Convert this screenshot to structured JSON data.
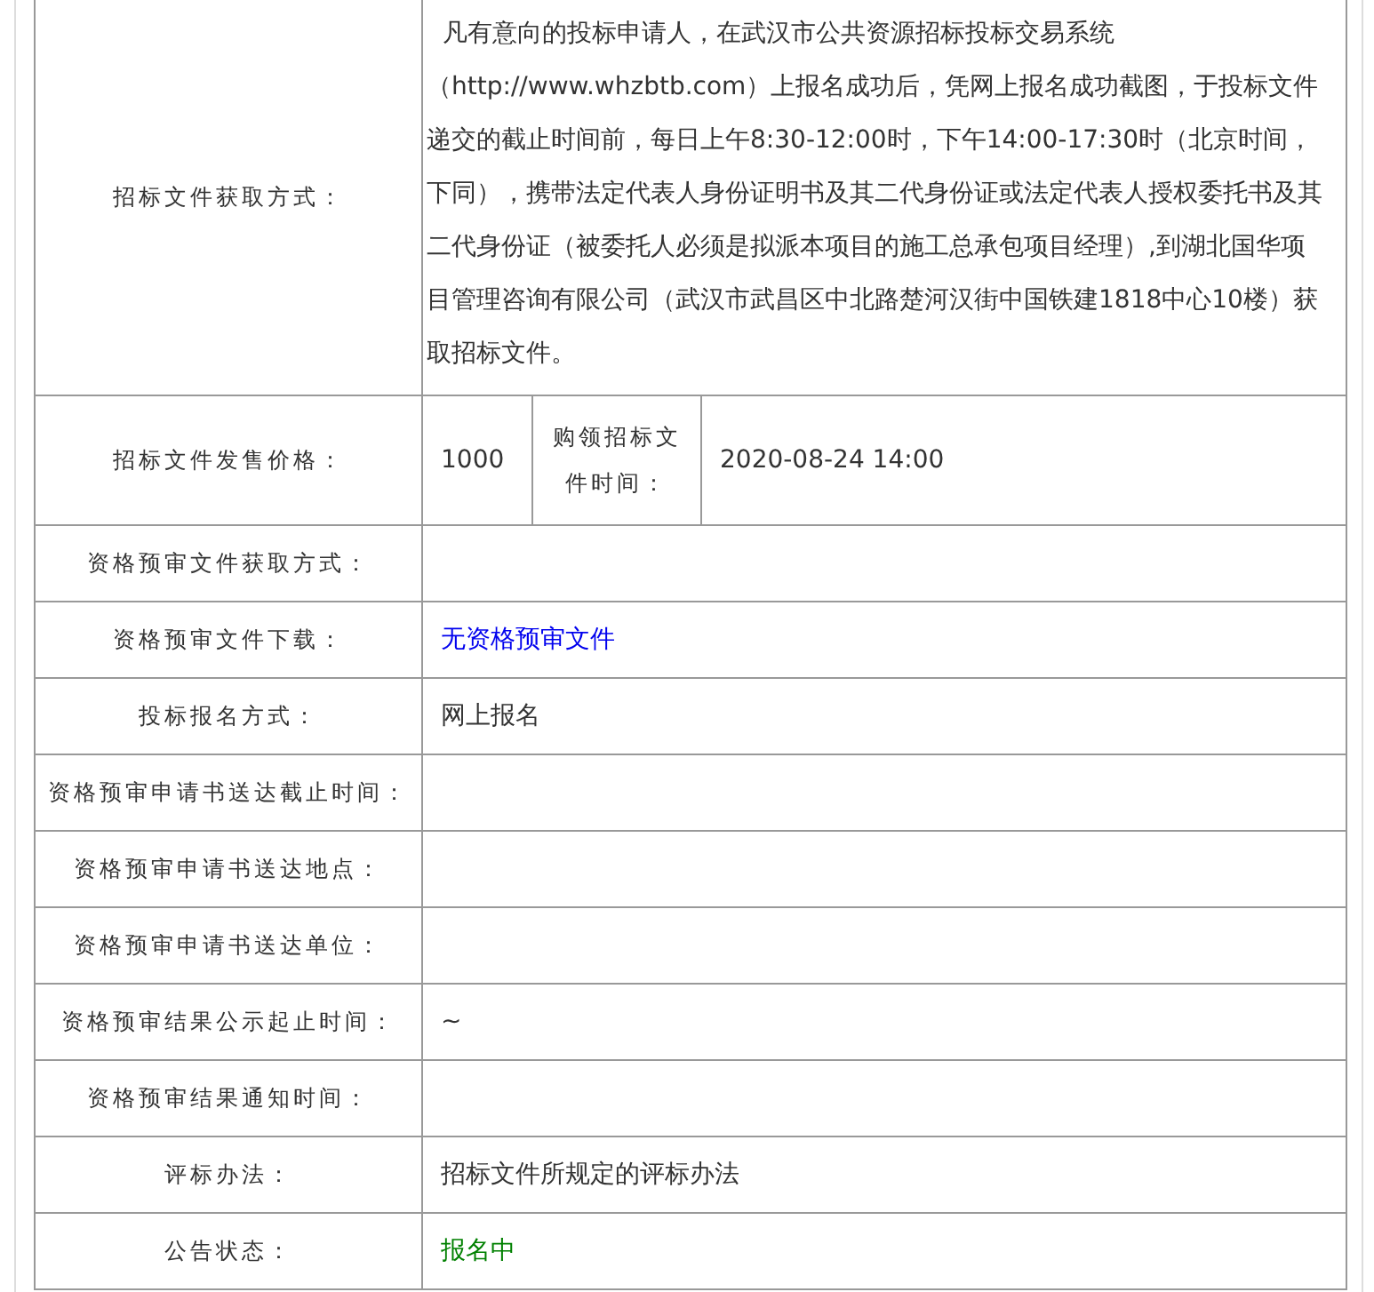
{
  "rows": [
    {
      "label": "招标文件获取方式：",
      "kind": "text",
      "text": "凡有意向的投标申请人，在武汉市公共资源招标投标交易系统（http://www.whzbtb.com）上报名成功后，凭网上报名成功截图，于投标文件递交的截止时间前，每日上午8:30-12:00时，下午14:00-17:30时（北京时间，下同），携带法定代表人身份证明书及其二代身份证或法定代表人授权委托书及其二代身份证（被委托人必须是拟派本项目的施工总承包项目经理）,到湖北国华项目管理咨询有限公司（武汉市武昌区中北路楚河汉街中国铁建1818中心10楼）获取招标文件。"
    },
    {
      "label": "招标文件发售价格：",
      "kind": "split",
      "text": "1000",
      "sublabel": "购领招标文件时间：",
      "subtext": "2020-08-24 14:00"
    },
    {
      "label": "资格预审文件获取方式：",
      "kind": "empty"
    },
    {
      "label": "资格预审文件下载：",
      "kind": "link",
      "text": "无资格预审文件"
    },
    {
      "label": "投标报名方式：",
      "kind": "text",
      "text": "网上报名"
    },
    {
      "label": "资格预审申请书送达截止时间：",
      "kind": "empty"
    },
    {
      "label": "资格预审申请书送达地点：",
      "kind": "empty"
    },
    {
      "label": "资格预审申请书送达单位：",
      "kind": "empty"
    },
    {
      "label": "资格预审结果公示起止时间：",
      "kind": "text",
      "text": "~"
    },
    {
      "label": "资格预审结果通知时间：",
      "kind": "empty"
    },
    {
      "label": "评标办法：",
      "kind": "text",
      "text": "招标文件所规定的评标办法"
    },
    {
      "label": "公告状态：",
      "kind": "status",
      "text": "报名中"
    }
  ]
}
